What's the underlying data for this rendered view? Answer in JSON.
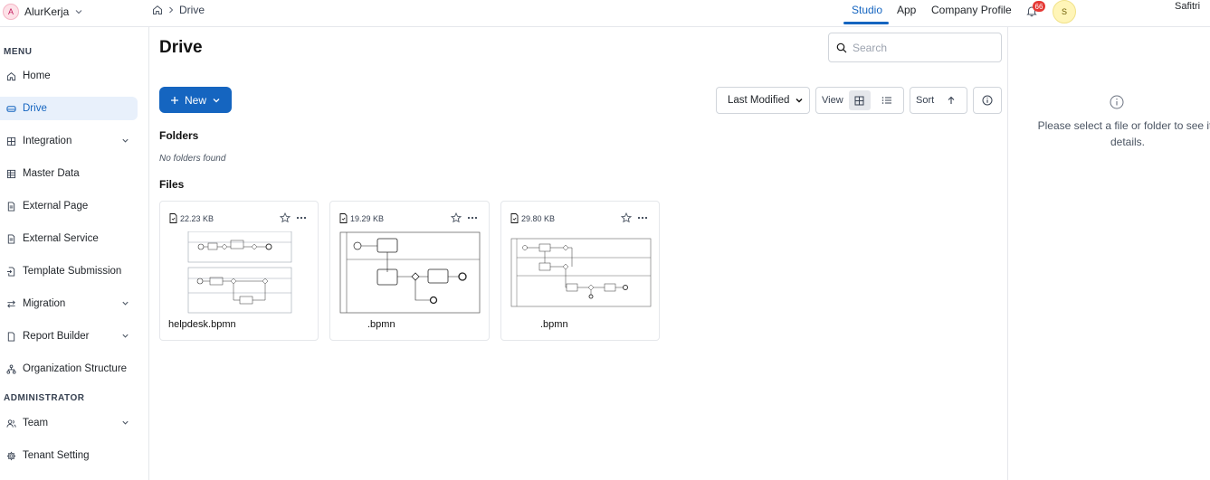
{
  "header": {
    "org_name": "AlurKerja",
    "org_initial": "A",
    "breadcrumb": [
      "Drive"
    ],
    "tabs": [
      {
        "label": "Studio",
        "active": true
      },
      {
        "label": "App",
        "active": false
      },
      {
        "label": "Company Profile",
        "active": false
      }
    ],
    "notification_count": "66",
    "user_initial": "S",
    "user_name": "Safitri"
  },
  "sidebar": {
    "menu_label": "MENU",
    "admin_label": "ADMINISTRATOR",
    "items": [
      {
        "label": "Home",
        "icon": "home-icon",
        "expandable": false,
        "active": false
      },
      {
        "label": "Drive",
        "icon": "drive-icon",
        "expandable": false,
        "active": true
      },
      {
        "label": "Integration",
        "icon": "grid-icon",
        "expandable": true,
        "active": false
      },
      {
        "label": "Master Data",
        "icon": "table-icon",
        "expandable": false,
        "active": false
      },
      {
        "label": "External Page",
        "icon": "document-icon",
        "expandable": false,
        "active": false
      },
      {
        "label": "External Service",
        "icon": "document-icon",
        "expandable": false,
        "active": false
      },
      {
        "label": "Template Submission",
        "icon": "file-arrow-icon",
        "expandable": false,
        "active": false
      },
      {
        "label": "Migration",
        "icon": "swap-icon",
        "expandable": true,
        "active": false
      },
      {
        "label": "Report Builder",
        "icon": "report-icon",
        "expandable": true,
        "active": false
      },
      {
        "label": "Organization Structure",
        "icon": "hierarchy-icon",
        "expandable": false,
        "active": false
      }
    ],
    "admin_items": [
      {
        "label": "Team",
        "icon": "team-icon",
        "expandable": true,
        "active": false
      },
      {
        "label": "Tenant Setting",
        "icon": "gear-icon",
        "expandable": false,
        "active": false
      }
    ]
  },
  "main": {
    "title": "Drive",
    "search_placeholder": "Search",
    "new_button_label": "New",
    "sort_field": "Last Modified",
    "view_label": "View",
    "sort_label": "Sort",
    "folders_title": "Folders",
    "folders_empty": "No folders found",
    "files_title": "Files",
    "files": [
      {
        "name": "helpdesk.bpmn",
        "size": "22.23 KB",
        "thumb": "bpmn-a"
      },
      {
        "name": ".bpmn",
        "size": "19.29 KB",
        "thumb": "bpmn-b"
      },
      {
        "name": ".bpmn",
        "size": "29.80 KB",
        "thumb": "bpmn-c"
      }
    ]
  },
  "detail": {
    "empty_message": "Please select a file or folder to see its details."
  },
  "colors": {
    "accent": "#1565c0",
    "active_bg": "#e8f0fb",
    "badge": "#e53935"
  }
}
